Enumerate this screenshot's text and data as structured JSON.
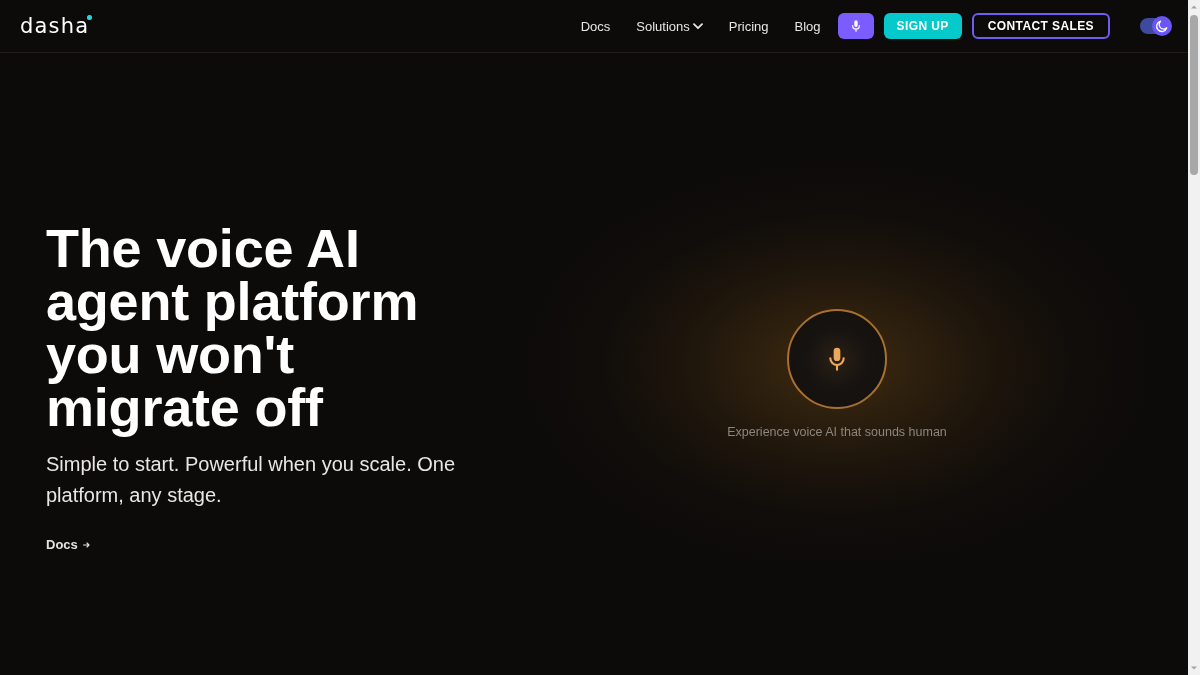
{
  "header": {
    "logo": "dasha",
    "nav": [
      {
        "label": "Docs",
        "dropdown": false
      },
      {
        "label": "Solutions",
        "dropdown": true
      },
      {
        "label": "Pricing",
        "dropdown": false
      },
      {
        "label": "Blog",
        "dropdown": false
      }
    ],
    "buttons": [
      {
        "kind": "mic"
      },
      {
        "kind": "filled",
        "label": "SIGN UP"
      },
      {
        "kind": "outlined",
        "label": "CONTACT SALES"
      }
    ],
    "theme_toggle": {
      "on": true
    }
  },
  "hero": {
    "headline": "The voice AI agent platform you won't migrate off",
    "subtitle": "Simple to start. Powerful when you scale. One platform, any stage.",
    "link": {
      "label": "Docs"
    }
  },
  "voice_demo": {
    "caption": "Experience voice AI that sounds human"
  }
}
